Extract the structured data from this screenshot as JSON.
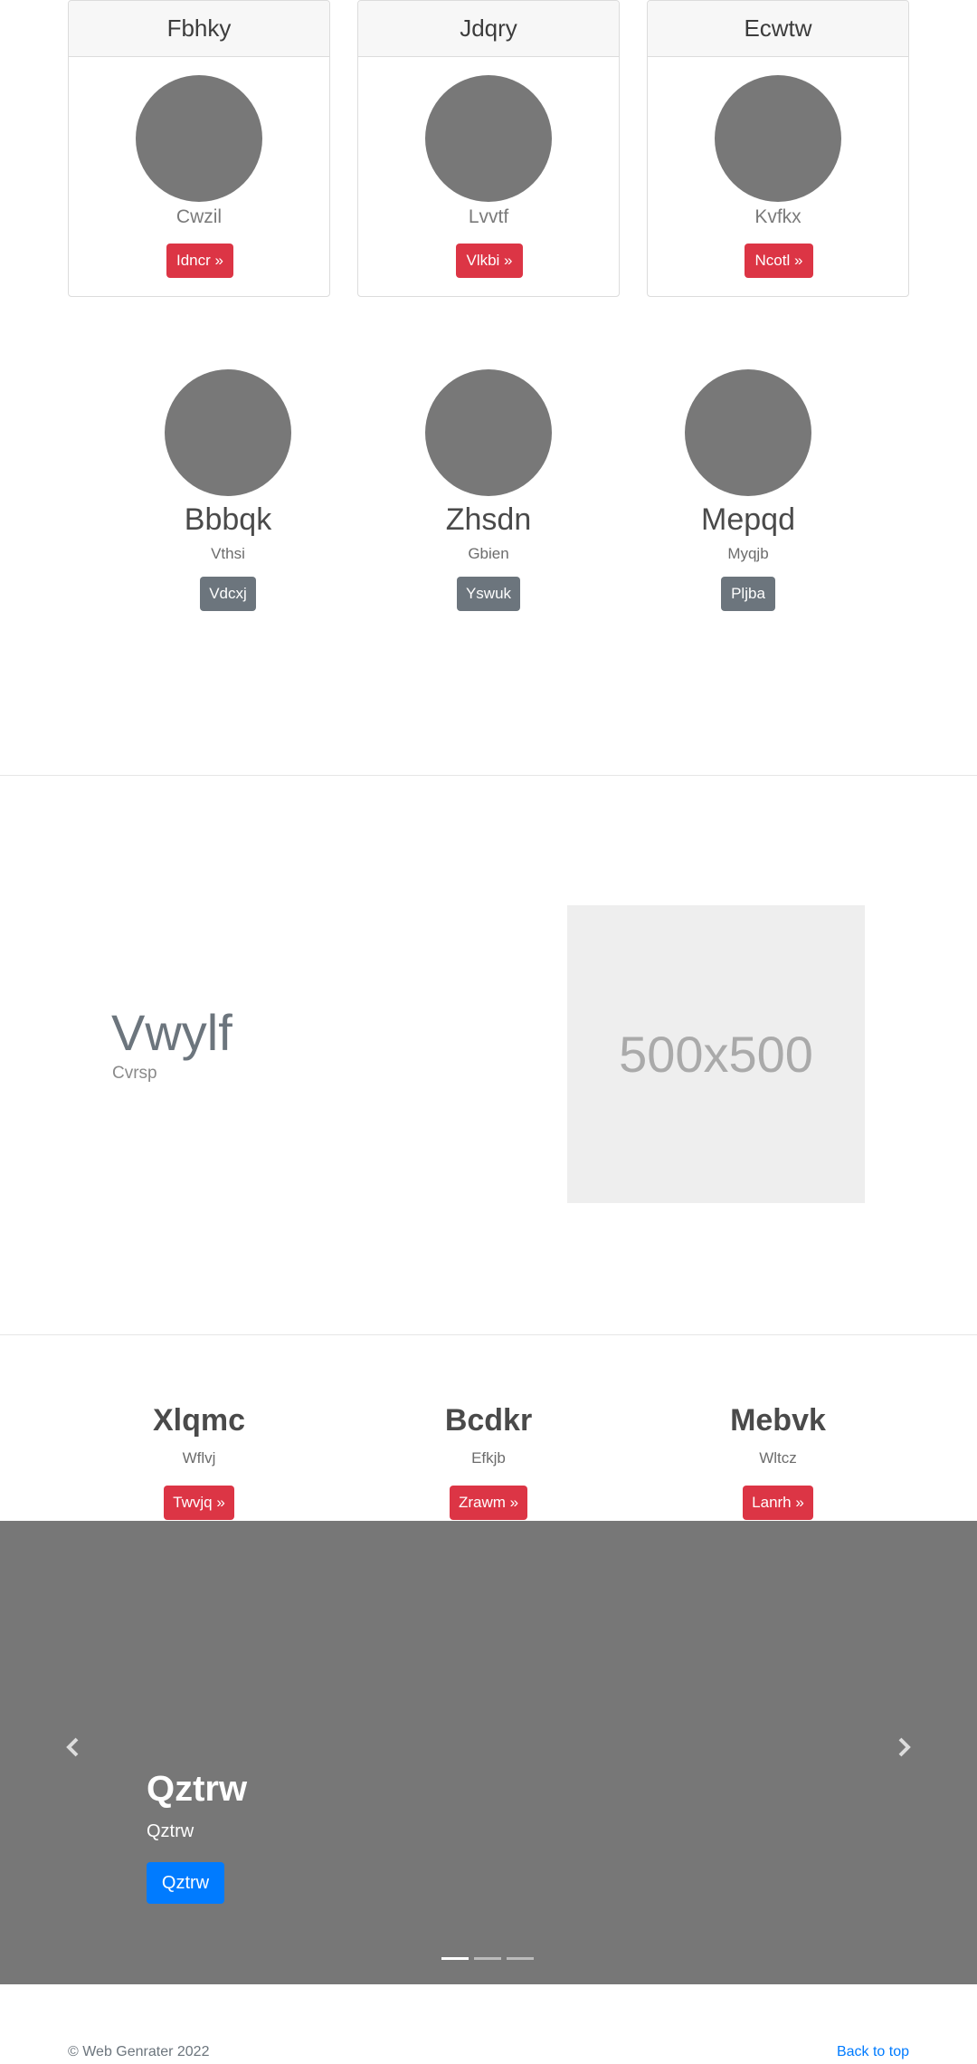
{
  "cards": [
    {
      "title": "Fbhky",
      "text": "Cwzil",
      "button": "Idncr »"
    },
    {
      "title": "Jdqry",
      "text": "Lvvtf",
      "button": "Vlkbi »"
    },
    {
      "title": "Ecwtw",
      "text": "Kvfkx",
      "button": "Ncotl »"
    }
  ],
  "team": [
    {
      "name": "Bbbqk",
      "role": "Vthsi",
      "button": "Vdcxj"
    },
    {
      "name": "Zhsdn",
      "role": "Gbien",
      "button": "Yswuk"
    },
    {
      "name": "Mepqd",
      "role": "Myqjb",
      "button": "Pljba"
    }
  ],
  "feature": {
    "title": "Vwylf",
    "subtitle": "Cvrsp",
    "placeholder": "500x500"
  },
  "columns": [
    {
      "title": "Xlqmc",
      "text": "Wflvj",
      "button": "Twvjq »"
    },
    {
      "title": "Bcdkr",
      "text": "Efkjb",
      "button": "Zrawm »"
    },
    {
      "title": "Mebvk",
      "text": "Wltcz",
      "button": "Lanrh »"
    }
  ],
  "carousel": {
    "title": "Qztrw",
    "text": "Qztrw",
    "button": "Qztrw",
    "prev_icon": "chevron-left-icon",
    "next_icon": "chevron-right-icon",
    "slide_count": 3,
    "active_slide": 1
  },
  "footer": {
    "copyright": "© Web Genrater 2022",
    "back_to_top": "Back to top"
  },
  "colors": {
    "danger": "#dc3545",
    "secondary": "#6c757d",
    "primary": "#007bff",
    "placeholder_gray": "#787878",
    "carousel_bg": "#777777"
  }
}
